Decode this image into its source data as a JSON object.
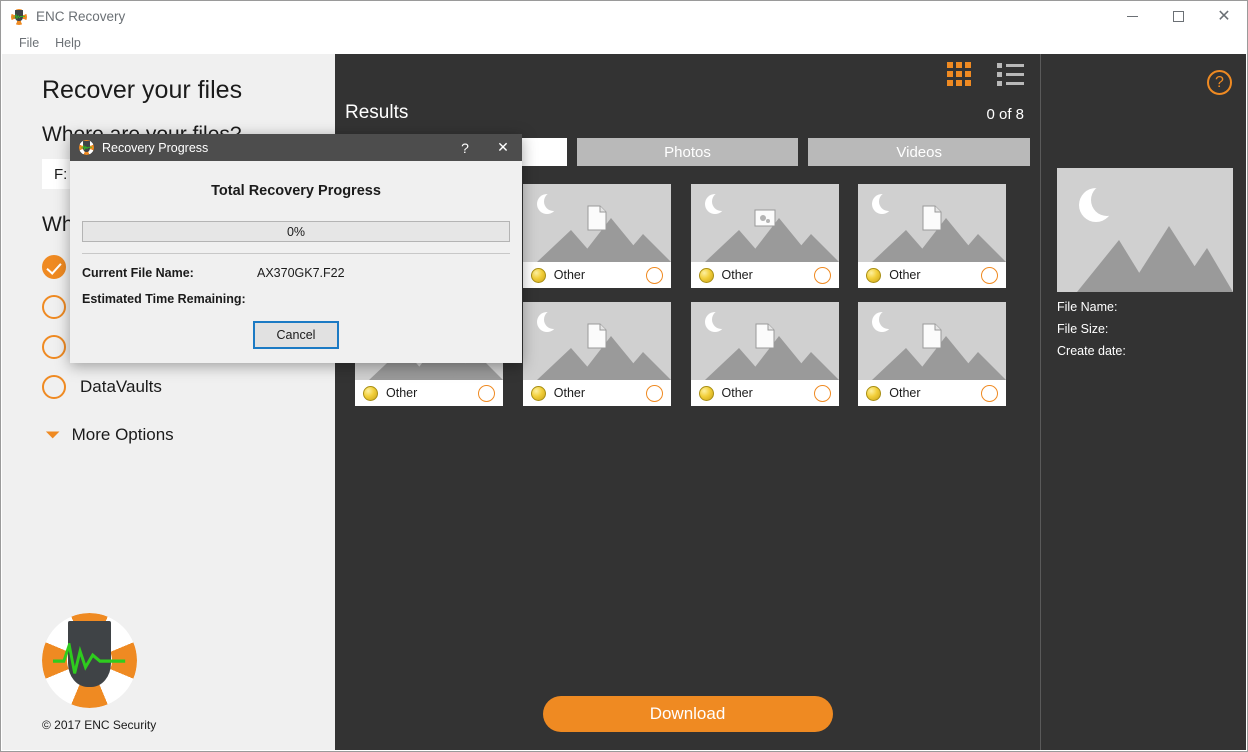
{
  "window": {
    "title": "ENC Recovery",
    "app_icon": "life-preserver-icon",
    "minimize": "—",
    "maximize": "□",
    "close": "✕"
  },
  "menu": {
    "items": [
      "File",
      "Help"
    ]
  },
  "sidebar": {
    "heading": "Recover your files",
    "question_location": "Where are your files?",
    "drive_value": "F:",
    "drive_placeholder": "F:",
    "question_type": "What are you looking for?",
    "options": [
      {
        "label": "",
        "checked": true
      },
      {
        "label": "",
        "checked": false
      },
      {
        "label": "",
        "checked": false
      },
      {
        "label": "DataVaults",
        "checked": false
      }
    ],
    "more_options": "More Options",
    "more_options_icon": "chevron-down-icon",
    "copyright": "© 2017 ENC Security"
  },
  "center": {
    "results_title": "Results",
    "results_count": "0 of 8",
    "grid_view_icon": "grid-view-icon",
    "list_view_icon": "list-view-icon",
    "tabs": [
      {
        "label": "",
        "active": true
      },
      {
        "label": "Photos",
        "active": false
      },
      {
        "label": "Videos",
        "active": false
      }
    ],
    "tiles": [
      {
        "label": "Other",
        "icon": "yellow-sphere-icon",
        "overlay": "file-icon",
        "selected": false
      },
      {
        "label": "Other",
        "icon": "yellow-sphere-icon",
        "overlay": "file-icon",
        "selected": false
      },
      {
        "label": "Other",
        "icon": "yellow-sphere-icon",
        "overlay": "settings-file-icon",
        "selected": false
      },
      {
        "label": "Other",
        "icon": "yellow-sphere-icon",
        "overlay": "file-icon",
        "selected": false
      },
      {
        "label": "Other",
        "icon": "yellow-sphere-icon",
        "overlay": "document-icon",
        "selected": false
      },
      {
        "label": "Other",
        "icon": "yellow-sphere-icon",
        "overlay": "file-icon",
        "selected": false
      },
      {
        "label": "Other",
        "icon": "yellow-sphere-icon",
        "overlay": "file-icon",
        "selected": false
      },
      {
        "label": "Other",
        "icon": "yellow-sphere-icon",
        "overlay": "file-icon",
        "selected": false
      }
    ],
    "download_label": "Download"
  },
  "right_panel": {
    "help_icon": "question-mark-icon",
    "preview_icon": "image-placeholder-icon",
    "file_name_label": "File Name:",
    "file_name_value": "",
    "file_size_label": "File Size:",
    "file_size_value": "",
    "create_date_label": "Create date:",
    "create_date_value": ""
  },
  "dialog": {
    "title": "Recovery Progress",
    "icon": "life-preserver-icon",
    "help_glyph": "?",
    "close_glyph": "✕",
    "heading": "Total Recovery Progress",
    "progress_text": "0%",
    "progress_value": 0,
    "current_file_label": "Current File Name:",
    "current_file_value": "AX370GK7.F22",
    "eta_label": "Estimated Time Remaining:",
    "eta_value": "",
    "cancel_label": "Cancel"
  },
  "colors": {
    "accent_orange": "#ef8a22",
    "dark_panel": "#333333",
    "sidebar_bg": "#f0f0f0",
    "dialog_titlebar": "#4d4d4d",
    "focus_blue": "#1b7ac4"
  }
}
